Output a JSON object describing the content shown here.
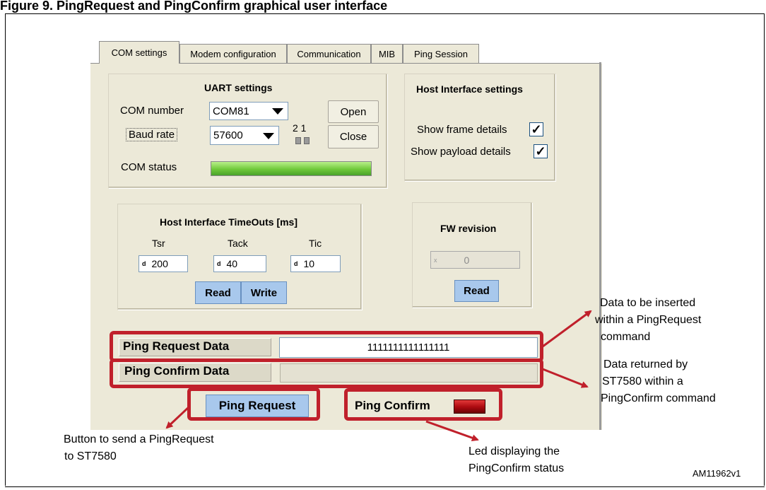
{
  "document": {
    "title": "Figure 9. PingRequest and PingConfirm graphical user interface",
    "figure_code": "AM11962v1"
  },
  "tabs": [
    {
      "label": "COM settings",
      "active": true
    },
    {
      "label": "Modem configuration",
      "active": false
    },
    {
      "label": "Communication",
      "active": false
    },
    {
      "label": "MIB",
      "active": false
    },
    {
      "label": "Ping Session",
      "active": false
    }
  ],
  "uart": {
    "title": "UART settings",
    "com_number_label": "COM number",
    "com_number_value": "COM81",
    "baud_rate_label": "Baud rate",
    "baud_rate_value": "57600",
    "switch_labels": "2 1",
    "open_label": "Open",
    "close_label": "Close",
    "com_status_label": "COM status",
    "com_status_color": "#6fc83a"
  },
  "host_interface": {
    "title": "Host Interface settings",
    "show_frame_label": "Show frame details",
    "show_frame_checked": true,
    "show_payload_label": "Show payload details",
    "show_payload_checked": true,
    "check_glyph": "✓"
  },
  "timeouts": {
    "title": "Host Interface TimeOuts [ms]",
    "fields": [
      {
        "label": "Tsr",
        "prefix": "d",
        "value": "200"
      },
      {
        "label": "Tack",
        "prefix": "d",
        "value": "40"
      },
      {
        "label": "Tic",
        "prefix": "d",
        "value": "10"
      }
    ],
    "read_label": "Read",
    "write_label": "Write"
  },
  "fw": {
    "title": "FW revision",
    "prefix": "x",
    "value": "0",
    "read_label": "Read"
  },
  "ping": {
    "request_label": "Ping Request Data",
    "request_value": "1111111111111111",
    "confirm_label": "Ping Confirm Data",
    "confirm_value": "",
    "request_button": "Ping Request",
    "confirm_led_label": "Ping Confirm",
    "led_color": "#b00c12"
  },
  "annotations": {
    "request_data_lines": [
      "Data to be inserted",
      "within a PingRequest",
      "command"
    ],
    "confirm_data_lines": [
      "Data returned by",
      "ST7580 within a",
      "PingConfirm command"
    ],
    "button_lines": [
      "Button to send a PingRequest",
      "to ST7580"
    ],
    "led_lines": [
      "Led displaying the",
      "PingConfirm status"
    ],
    "accent_color": "#c0202b"
  }
}
